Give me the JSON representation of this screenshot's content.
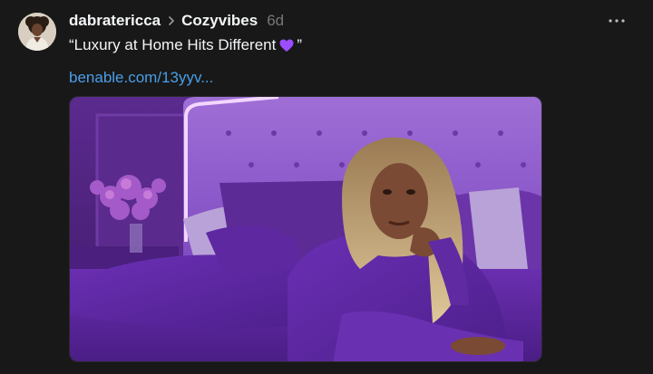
{
  "post": {
    "username": "dabratericca",
    "community": "Cozyvibes",
    "time": "6d",
    "caption_before": "“Luxury at Home Hits Different",
    "caption_after": "”",
    "heart_emoji": "purple-heart",
    "link_text": "benable.com/13yyv...",
    "image_icon": "photo-woman-purple-bedroom"
  },
  "colors": {
    "background": "#181818",
    "text_primary": "#f3f5f7",
    "text_secondary": "#777777",
    "link": "#4a9ee8",
    "heart": "#9b4dff"
  }
}
